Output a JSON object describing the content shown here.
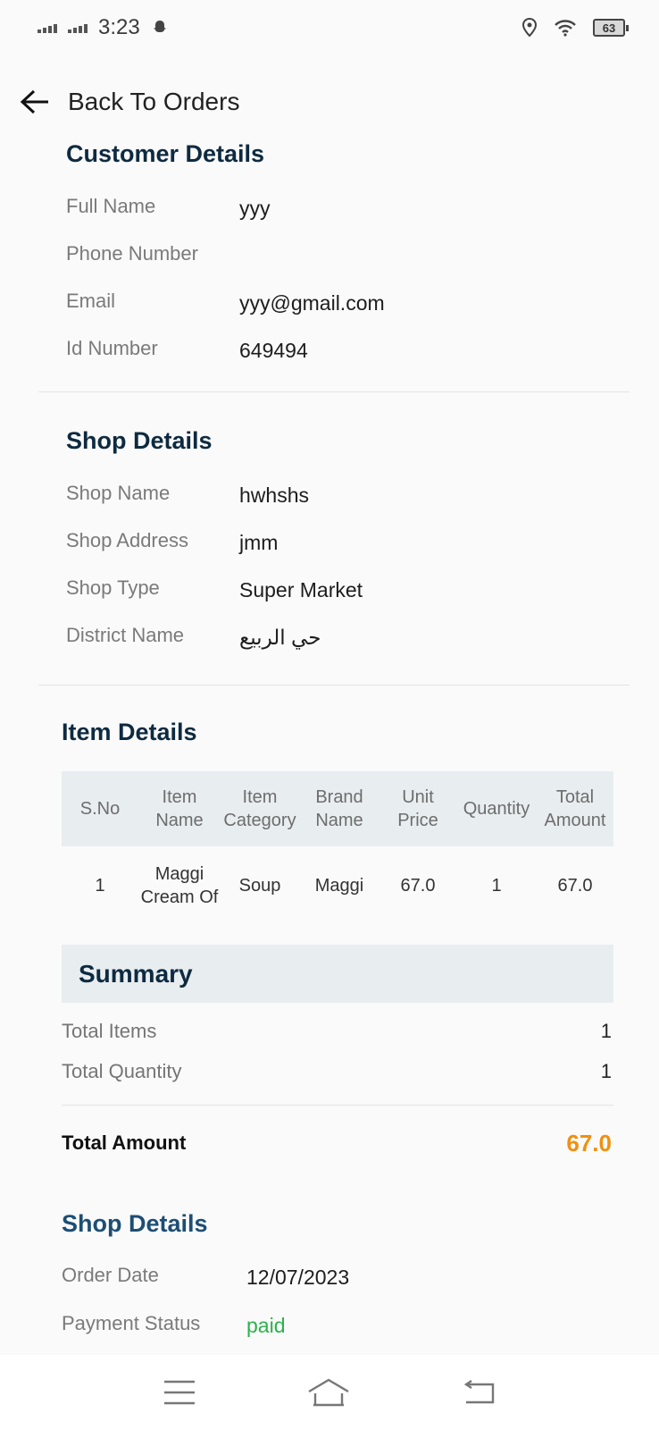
{
  "status_bar": {
    "time": "3:23",
    "battery": "63"
  },
  "header": {
    "back_label": "Back To Orders"
  },
  "customer": {
    "title": "Customer Details",
    "rows": [
      {
        "label": "Full Name",
        "value": "yyy"
      },
      {
        "label": "Phone Number",
        "value": ""
      },
      {
        "label": "Email",
        "value": "yyy@gmail.com"
      },
      {
        "label": "Id Number",
        "value": "649494"
      }
    ]
  },
  "shop": {
    "title": "Shop Details",
    "rows": [
      {
        "label": "Shop Name",
        "value": "hwhshs"
      },
      {
        "label": "Shop Address",
        "value": "jmm"
      },
      {
        "label": "Shop Type",
        "value": "Super Market"
      },
      {
        "label": "District Name",
        "value": "حي الربيع"
      }
    ]
  },
  "items": {
    "title": "Item Details",
    "columns": [
      "S.No",
      "Item Name",
      "Item Category",
      "Brand Name",
      "Unit Price",
      "Quantity",
      "Total Amount"
    ],
    "rows": [
      [
        "1",
        "Maggi Cream Of",
        "Soup",
        "Maggi",
        "67.0",
        "1",
        "67.0"
      ]
    ]
  },
  "summary": {
    "title": "Summary",
    "total_items_label": "Total Items",
    "total_items_value": "1",
    "total_quantity_label": "Total Quantity",
    "total_quantity_value": "1",
    "total_amount_label": "Total Amount",
    "total_amount_value": "67.0"
  },
  "order": {
    "title": "Shop Details",
    "order_date_label": "Order Date",
    "order_date_value": "12/07/2023",
    "payment_status_label": "Payment Status",
    "payment_status_value": "paid"
  },
  "colors": {
    "title": "#0e2a40",
    "accent_amount": "#f0900f",
    "paid": "#2bb24c",
    "order_title": "#1d4e74"
  }
}
